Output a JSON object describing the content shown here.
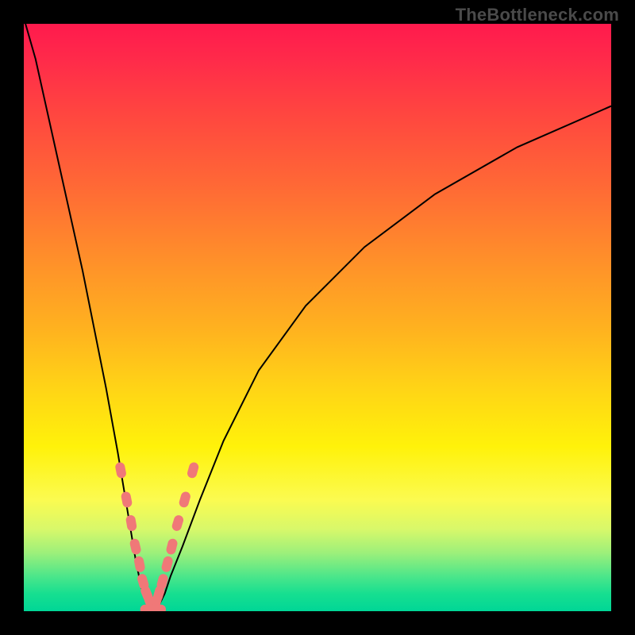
{
  "branding": "TheBottleneck.com",
  "chart_data": {
    "type": "line",
    "title": "",
    "xlabel": "",
    "ylabel": "",
    "xlim": [
      0,
      100
    ],
    "ylim": [
      0,
      100
    ],
    "notch_x": 22,
    "left_branch": {
      "x": [
        0,
        2,
        4,
        6,
        8,
        10,
        12,
        14,
        16,
        18,
        19,
        20,
        21,
        22
      ],
      "y": [
        101,
        94,
        85,
        76,
        67,
        58,
        48,
        38,
        27,
        15,
        9,
        4,
        1,
        0
      ]
    },
    "right_branch": {
      "x": [
        22,
        23,
        24,
        25,
        27,
        30,
        34,
        40,
        48,
        58,
        70,
        84,
        100
      ],
      "y": [
        0,
        1,
        3,
        6,
        11,
        19,
        29,
        41,
        52,
        62,
        71,
        79,
        86
      ]
    },
    "beads_left": {
      "x": [
        16.5,
        17.5,
        18.3,
        19.0,
        19.7,
        20.3,
        20.9,
        21.5
      ],
      "y": [
        24,
        19,
        15,
        11,
        8,
        5,
        3,
        1.5
      ]
    },
    "beads_right": {
      "x": [
        22.5,
        23.0,
        23.6,
        24.4,
        25.2,
        26.2,
        27.4,
        28.8
      ],
      "y": [
        1.5,
        3,
        5,
        8,
        11,
        15,
        19,
        24
      ]
    },
    "bead_color": "#f07878",
    "curve_color": "#000000"
  }
}
